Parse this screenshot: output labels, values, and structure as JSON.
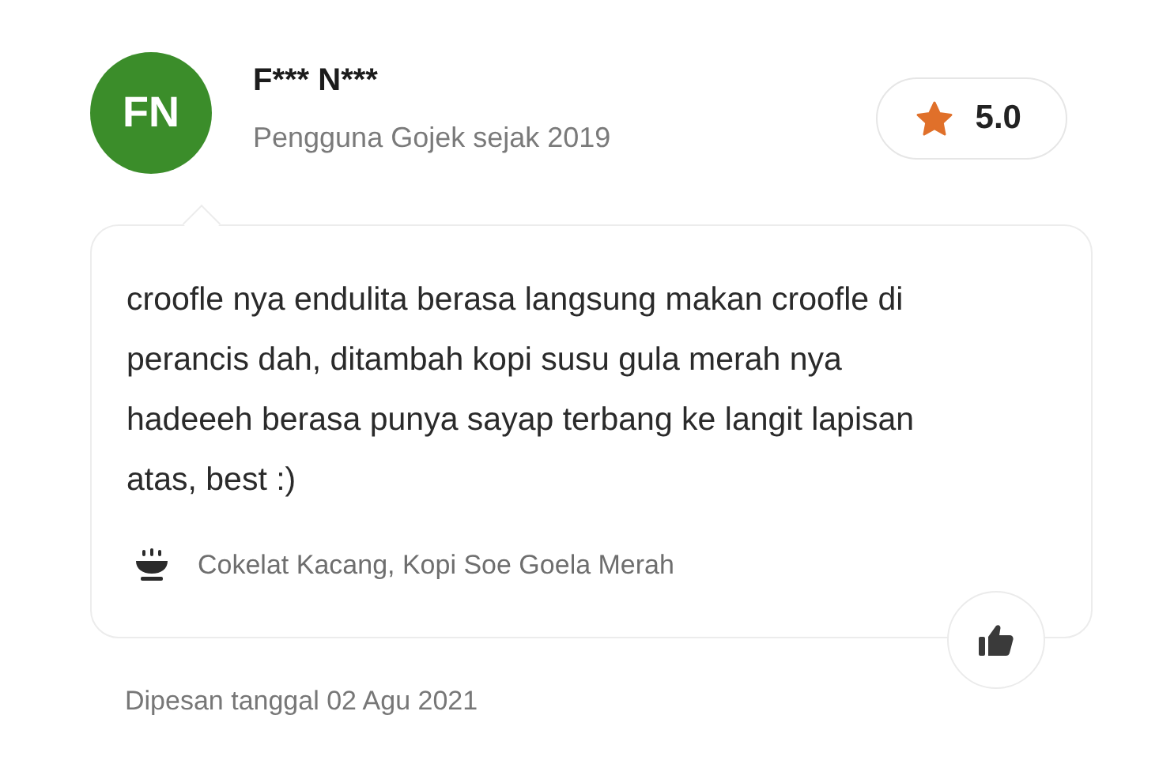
{
  "reviewer": {
    "initials": "FN",
    "name": "F*** N***",
    "subtitle": "Pengguna Gojek sejak 2019"
  },
  "rating": "5.0",
  "review": {
    "text": "croofle nya endulita berasa langsung makan croofle di perancis dah, ditambah kopi susu gula merah nya hadeeeh berasa punya sayap terbang ke langit lapisan atas, best :)",
    "items": "Cokelat Kacang, Kopi Soe Goela Merah"
  },
  "order_date": "Dipesan tanggal 02 Agu 2021"
}
